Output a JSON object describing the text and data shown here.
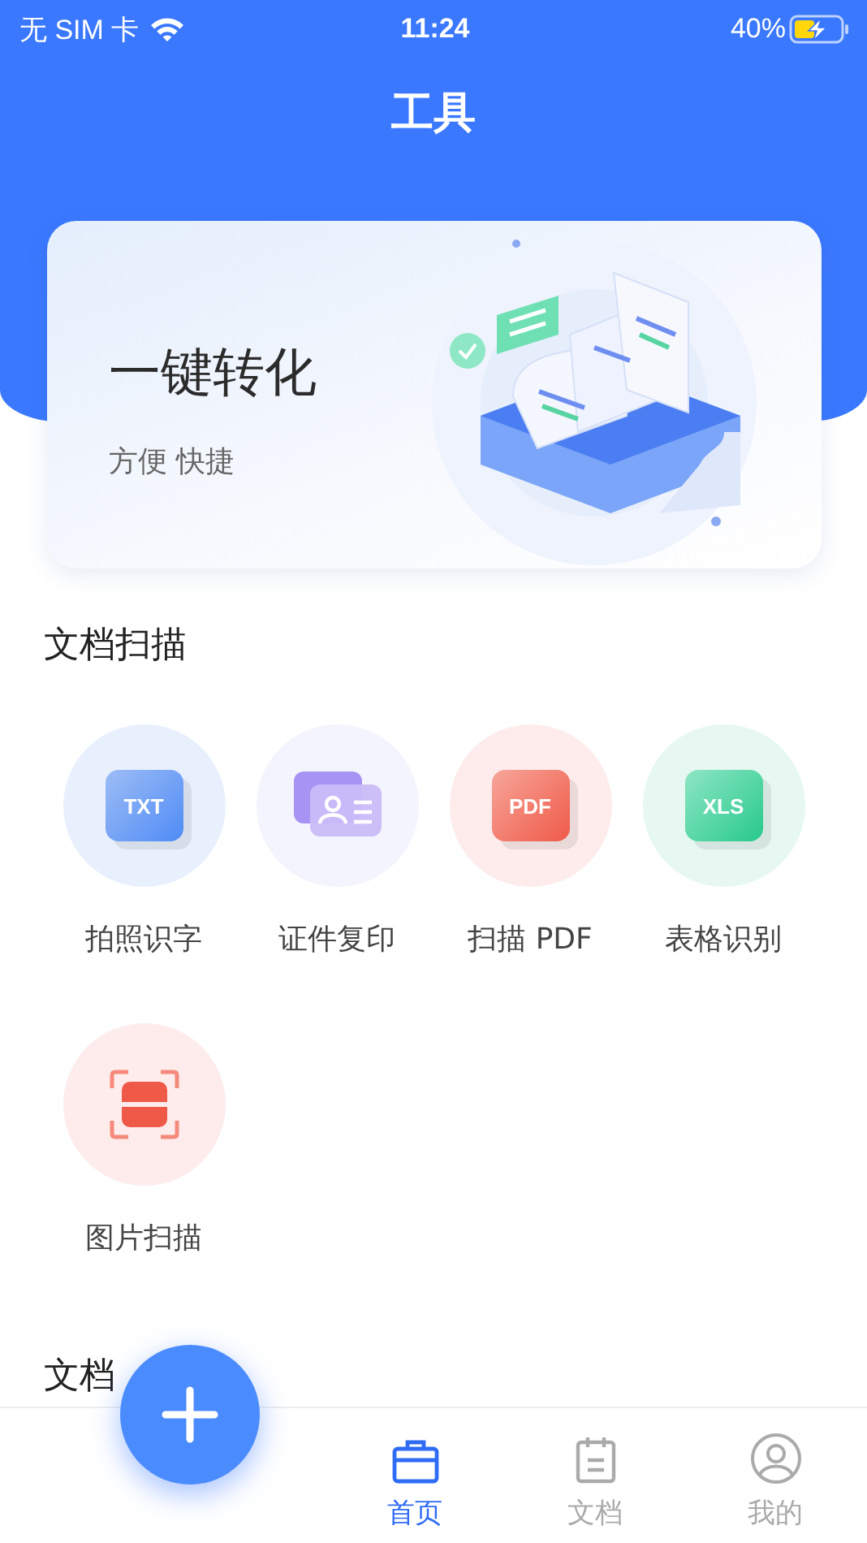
{
  "status_bar": {
    "carrier": "无 SIM 卡",
    "time": "11:24",
    "battery": "40%",
    "charging": true
  },
  "title": "工具",
  "banner": {
    "title": "一键转化",
    "subtitle": "方便 快捷"
  },
  "sections": [
    {
      "title": "文档扫描",
      "tools": [
        {
          "kind": "txt",
          "label": "拍照识字",
          "badge": "TXT"
        },
        {
          "kind": "id",
          "label": "证件复印"
        },
        {
          "kind": "pdf",
          "label": "扫描 PDF",
          "badge": "PDF"
        },
        {
          "kind": "xls",
          "label": "表格识别",
          "badge": "XLS"
        },
        {
          "kind": "scan",
          "label": "图片扫描"
        }
      ]
    },
    {
      "title": "文档"
    }
  ],
  "tabs": [
    {
      "kind": "home",
      "label": "首页",
      "selected": true
    },
    {
      "kind": "docs",
      "label": "文档",
      "selected": false
    },
    {
      "kind": "me",
      "label": "我的",
      "selected": false
    }
  ]
}
